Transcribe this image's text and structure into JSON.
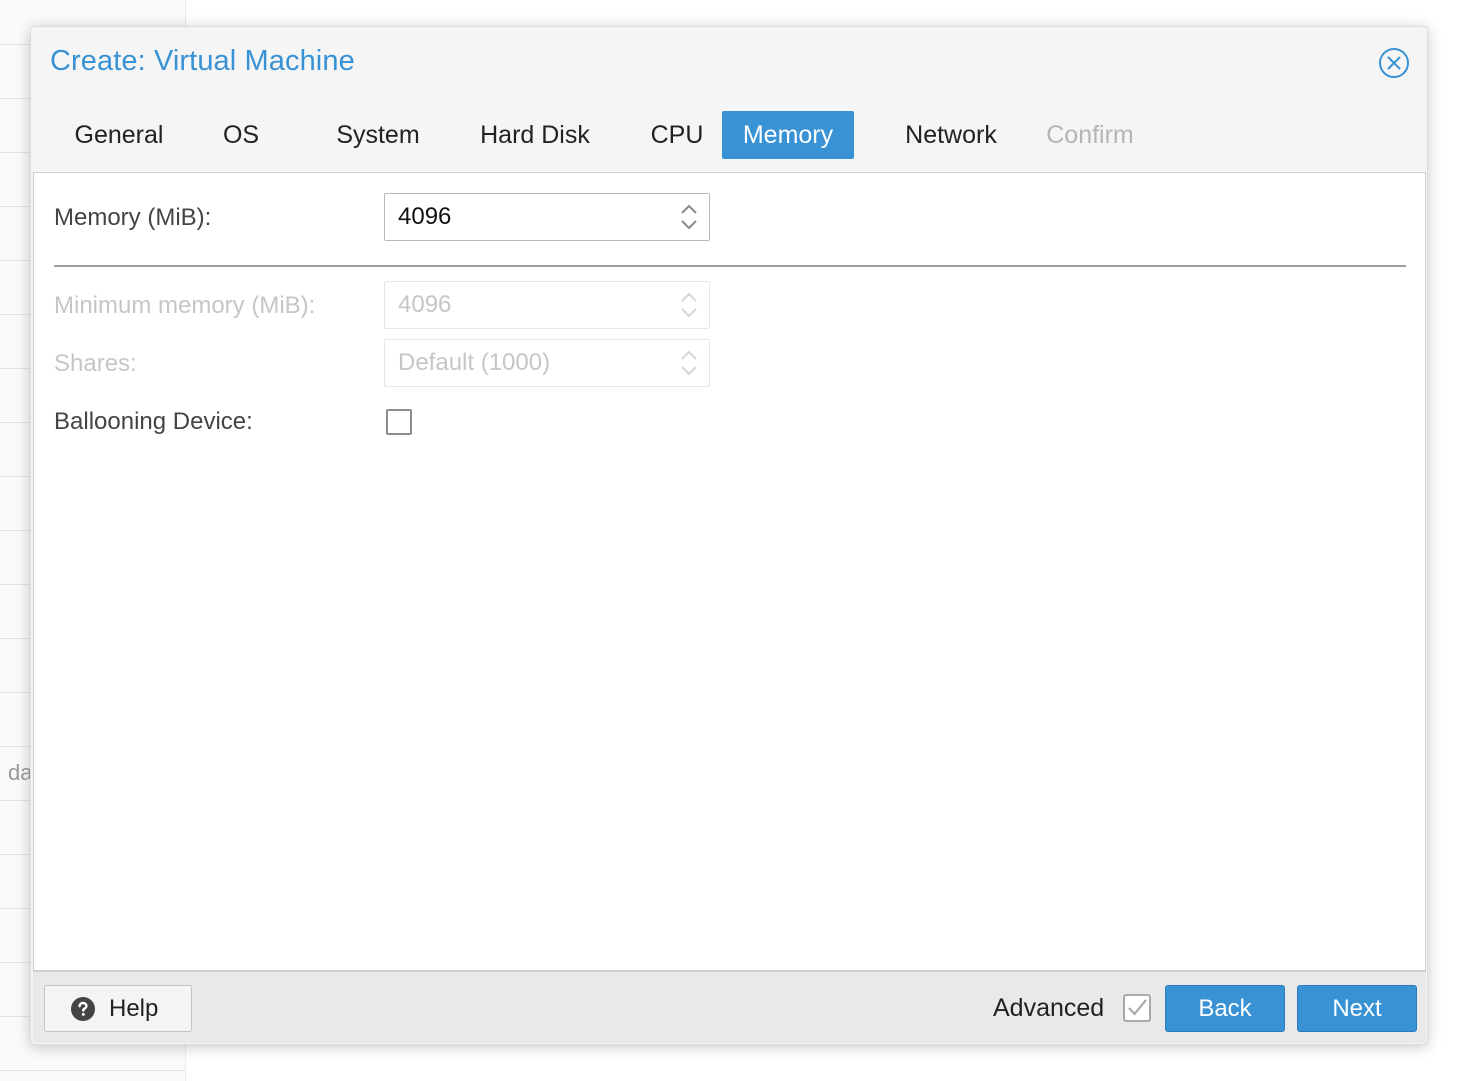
{
  "background": {
    "fragment_text": "da"
  },
  "dialog": {
    "title": "Create: Virtual Machine",
    "close_icon": "close-circle-icon",
    "accent_color": "#3892d4"
  },
  "tabs": [
    {
      "label": "General",
      "state": "normal"
    },
    {
      "label": "OS",
      "state": "normal"
    },
    {
      "label": "System",
      "state": "normal"
    },
    {
      "label": "Hard Disk",
      "state": "normal"
    },
    {
      "label": "CPU",
      "state": "normal"
    },
    {
      "label": "Memory",
      "state": "active"
    },
    {
      "label": "Network",
      "state": "normal"
    },
    {
      "label": "Confirm",
      "state": "disabled"
    }
  ],
  "form": {
    "memory": {
      "label": "Memory (MiB):",
      "value": "4096"
    },
    "minimum_memory": {
      "label": "Minimum memory (MiB):",
      "value": "4096"
    },
    "shares": {
      "label": "Shares:",
      "value": "Default (1000)"
    },
    "ballooning": {
      "label": "Ballooning Device:",
      "checked": false
    }
  },
  "footer": {
    "help_label": "Help",
    "help_icon": "question-circle-icon",
    "advanced_label": "Advanced",
    "advanced_checked": true,
    "back_label": "Back",
    "next_label": "Next"
  }
}
